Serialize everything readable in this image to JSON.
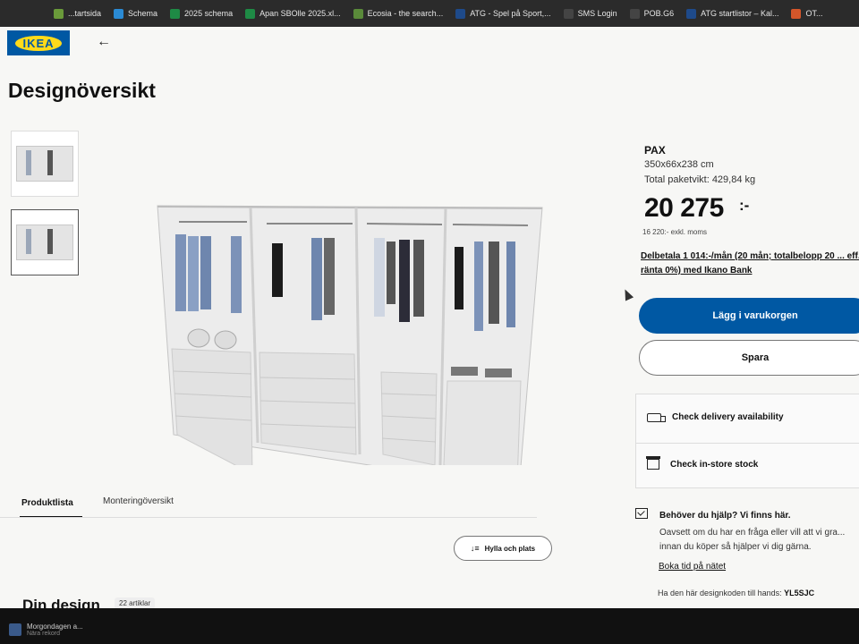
{
  "bookmarks": [
    {
      "label": "...tartsida",
      "color": "#6a9a3a"
    },
    {
      "label": "Schema",
      "color": "#2a8ad4"
    },
    {
      "label": "2025 schema",
      "color": "#1e8a45"
    },
    {
      "label": "Apan SBOlle 2025.xl...",
      "color": "#1e8a45"
    },
    {
      "label": "Ecosia - the search...",
      "color": "#5a8a3a"
    },
    {
      "label": "ATG - Spel på Sport,...",
      "color": "#1e4a8a"
    },
    {
      "label": "SMS Login",
      "color": "#444444"
    },
    {
      "label": "POB.G6",
      "color": "#444444"
    },
    {
      "label": "ATG startlistor – Kal...",
      "color": "#1e4a8a"
    },
    {
      "label": "OT...",
      "color": "#d4562a"
    }
  ],
  "header": {
    "logo": "IKEA",
    "back_icon": "←",
    "title": "Designöversikt"
  },
  "product": {
    "name": "PAX",
    "dimensions": "350x66x238 cm",
    "weight": "Total paketvikt: 429,84 kg",
    "price": "20 275",
    "price_suffix": ":-",
    "price_excl": "16 220:- exkl. moms",
    "finance": "Delbetala 1 014:-/mån (20 mån; totalbelopp 20 ... eff. ränta 0%) med Ikano Bank"
  },
  "actions": {
    "add_to_cart": "Lägg i varukorgen",
    "save": "Spara"
  },
  "availability": {
    "delivery": "Check delivery availability",
    "store": "Check in-store stock"
  },
  "help": {
    "title": "Behöver du hjälp? Vi finns här.",
    "text": "Oavsett om du har en fråga eller vill att vi gra... innan du köper så hjälper vi dig gärna.",
    "link": "Boka tid på nätet",
    "code_prefix": "Ha den här designkoden till hands:",
    "code": "YL5SJC"
  },
  "tabs": {
    "product_list": "Produktlista",
    "assembly": "Monteringöversikt"
  },
  "shelf_button": "Hylla och plats",
  "sort_icon": "↓≡",
  "design": {
    "title": "Din design",
    "count": "22 artiklar"
  },
  "taskbar": {
    "title": "Morgondagen a...",
    "subtitle": "Nära rekord"
  }
}
